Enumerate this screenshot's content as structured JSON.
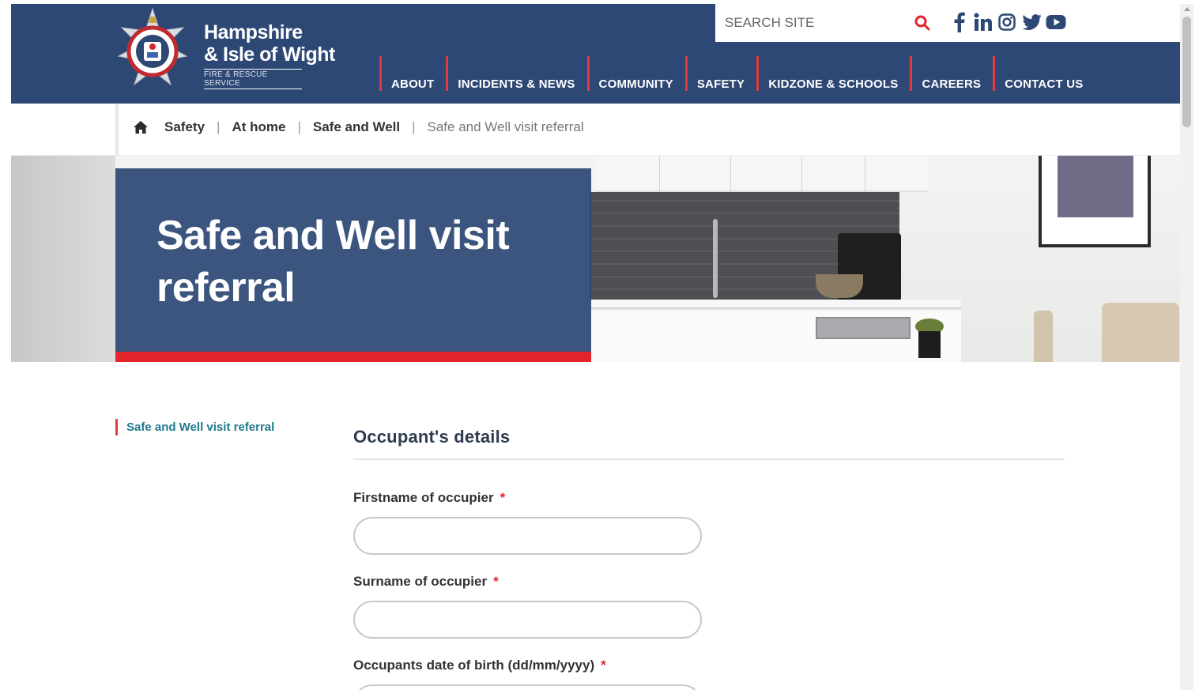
{
  "brand": {
    "line1": "Hampshire",
    "line2": "& Isle of Wight",
    "line3": "FIRE & RESCUE SERVICE"
  },
  "search": {
    "placeholder": "SEARCH SITE",
    "icon": "search-icon"
  },
  "social": [
    {
      "name": "facebook",
      "icon": "facebook-icon"
    },
    {
      "name": "linkedin",
      "icon": "linkedin-icon"
    },
    {
      "name": "instagram",
      "icon": "instagram-icon"
    },
    {
      "name": "twitter",
      "icon": "twitter-icon"
    },
    {
      "name": "youtube",
      "icon": "youtube-icon"
    }
  ],
  "nav": {
    "items": [
      {
        "label": "ABOUT"
      },
      {
        "label": "INCIDENTS & NEWS"
      },
      {
        "label": "COMMUNITY"
      },
      {
        "label": "SAFETY"
      },
      {
        "label": "KIDZONE & SCHOOLS"
      },
      {
        "label": "CAREERS"
      },
      {
        "label": "CONTACT US"
      }
    ]
  },
  "breadcrumb": {
    "home_icon": "home-icon",
    "items": [
      {
        "label": "Safety"
      },
      {
        "label": "At home"
      },
      {
        "label": "Safe and Well"
      }
    ],
    "separator": "|",
    "current": "Safe and Well visit referral"
  },
  "hero": {
    "title": "Safe and Well visit referral"
  },
  "sidebar": {
    "active_link": "Safe and Well visit referral"
  },
  "form": {
    "section_title": "Occupant's details",
    "required_marker": "*",
    "fields": [
      {
        "label": "Firstname of occupier",
        "value": ""
      },
      {
        "label": "Surname of occupier",
        "value": ""
      },
      {
        "label": "Occupants date of birth (dd/mm/yyyy)",
        "value": ""
      }
    ]
  },
  "colors": {
    "brand_navy": "#2d4874",
    "accent_red": "#e3242b",
    "link_teal": "#1f7a8c"
  }
}
